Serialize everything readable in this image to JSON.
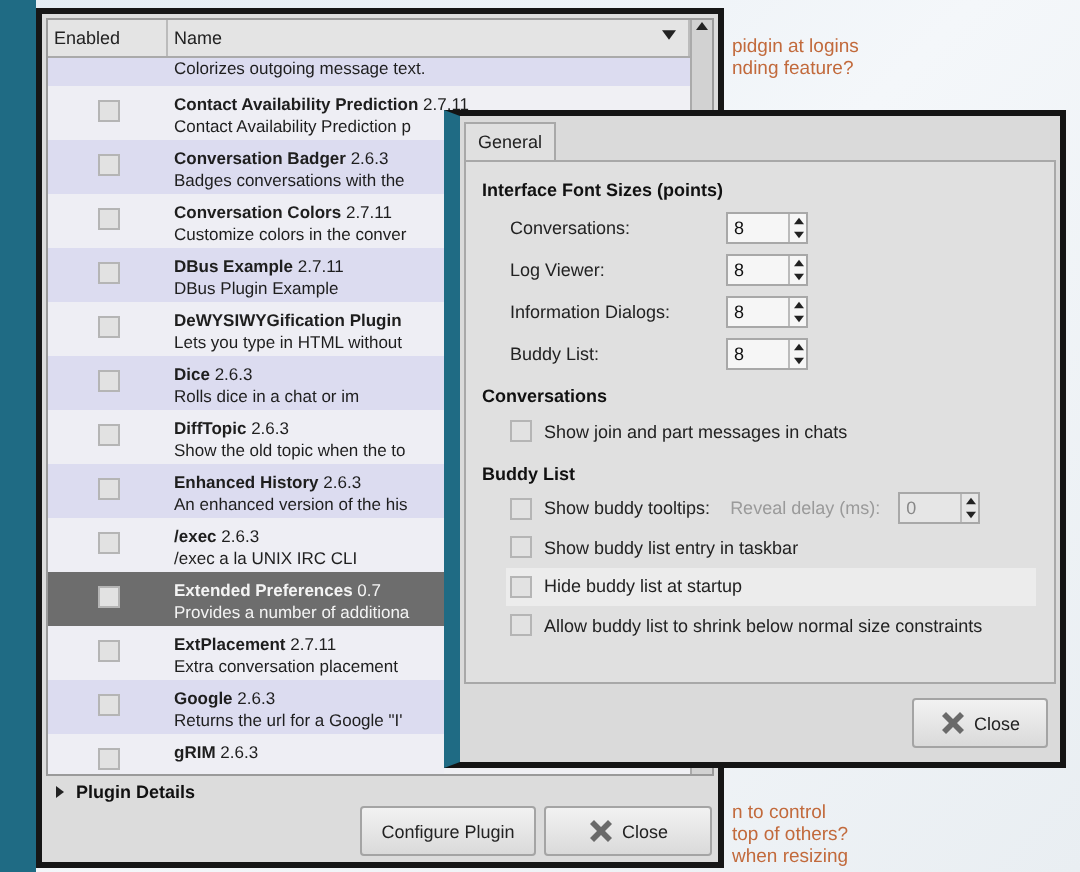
{
  "background_page": {
    "top_lines": [
      "pidgin at logins",
      "nding feature?"
    ],
    "bottom_lines": [
      "n to control",
      "top of others?",
      "when resizing"
    ]
  },
  "plugins_window": {
    "columns": [
      "Enabled",
      "Name"
    ],
    "plugins": [
      {
        "description": "Colorizes outgoing message text.",
        "selected": false
      },
      {
        "name": "Contact Availability Prediction",
        "version": "2.7.11",
        "description": "Contact Availability Prediction p",
        "enabled": false,
        "selected": false
      },
      {
        "name": "Conversation Badger",
        "version": "2.6.3",
        "description": "Badges conversations with the",
        "enabled": false,
        "selected": false
      },
      {
        "name": "Conversation Colors",
        "version": "2.7.11",
        "description": "Customize colors in the conver",
        "enabled": false,
        "selected": false
      },
      {
        "name": "DBus Example",
        "version": "2.7.11",
        "description": "DBus Plugin Example",
        "enabled": false,
        "selected": false
      },
      {
        "name": "DeWYSIWYGification Plugin",
        "description": "Lets you type in HTML without",
        "enabled": false,
        "selected": false
      },
      {
        "name": "Dice",
        "version": "2.6.3",
        "description": "Rolls dice in a chat or im",
        "enabled": false,
        "selected": false
      },
      {
        "name": "DiffTopic",
        "version": "2.6.3",
        "description": "Show the old topic when the to",
        "enabled": false,
        "selected": false
      },
      {
        "name": "Enhanced History",
        "version": "2.6.3",
        "description": "An enhanced version of the his",
        "enabled": false,
        "selected": false
      },
      {
        "name": "/exec",
        "version": "2.6.3",
        "description": "/exec a la UNIX IRC CLI",
        "enabled": false,
        "selected": false
      },
      {
        "name": "Extended Preferences",
        "version": "0.7",
        "description": "Provides a number of additiona",
        "enabled": false,
        "selected": true
      },
      {
        "name": "ExtPlacement",
        "version": "2.7.11",
        "description": "Extra conversation placement",
        "enabled": false,
        "selected": false
      },
      {
        "name": "Google",
        "version": "2.6.3",
        "description": "Returns the url for a Google \"I'",
        "enabled": false,
        "selected": false
      },
      {
        "name": "gRIM",
        "version": "2.6.3",
        "enabled": false,
        "selected": false
      }
    ],
    "details": {
      "label": "Plugin Details",
      "expanded": false
    },
    "buttons": [
      {
        "kind": "configure",
        "label": "Configure Plugin"
      },
      {
        "kind": "close",
        "label": "Close"
      }
    ]
  },
  "preferences_window": {
    "tabs": [
      {
        "label": "General",
        "selected": true
      }
    ],
    "sections": [
      {
        "title": "Interface Font Sizes (points)",
        "items": [
          {
            "kind": "spin",
            "label": "Conversations:",
            "value": "8"
          },
          {
            "kind": "spin",
            "label": "Log Viewer:",
            "value": "8"
          },
          {
            "kind": "spin",
            "label": "Information Dialogs:",
            "value": "8"
          },
          {
            "kind": "spin",
            "label": "Buddy List:",
            "value": "8"
          }
        ]
      },
      {
        "title": "Conversations",
        "items": [
          {
            "kind": "check",
            "label": "Show join and part messages in chats",
            "checked": false
          }
        ]
      },
      {
        "title": "Buddy List",
        "items": [
          {
            "kind": "check",
            "label": "Show buddy tooltips:",
            "checked": false,
            "delay": {
              "label": "Reveal delay (ms):",
              "value": "0",
              "disabled": true
            }
          },
          {
            "kind": "check",
            "label": "Show buddy list entry in taskbar",
            "checked": false
          },
          {
            "kind": "check",
            "label": "Hide buddy list at startup",
            "checked": false,
            "hovered": true
          },
          {
            "kind": "check",
            "label": "Allow buddy list to shrink below normal size constraints",
            "checked": false
          }
        ]
      }
    ],
    "close_button": {
      "label": "Close"
    }
  }
}
